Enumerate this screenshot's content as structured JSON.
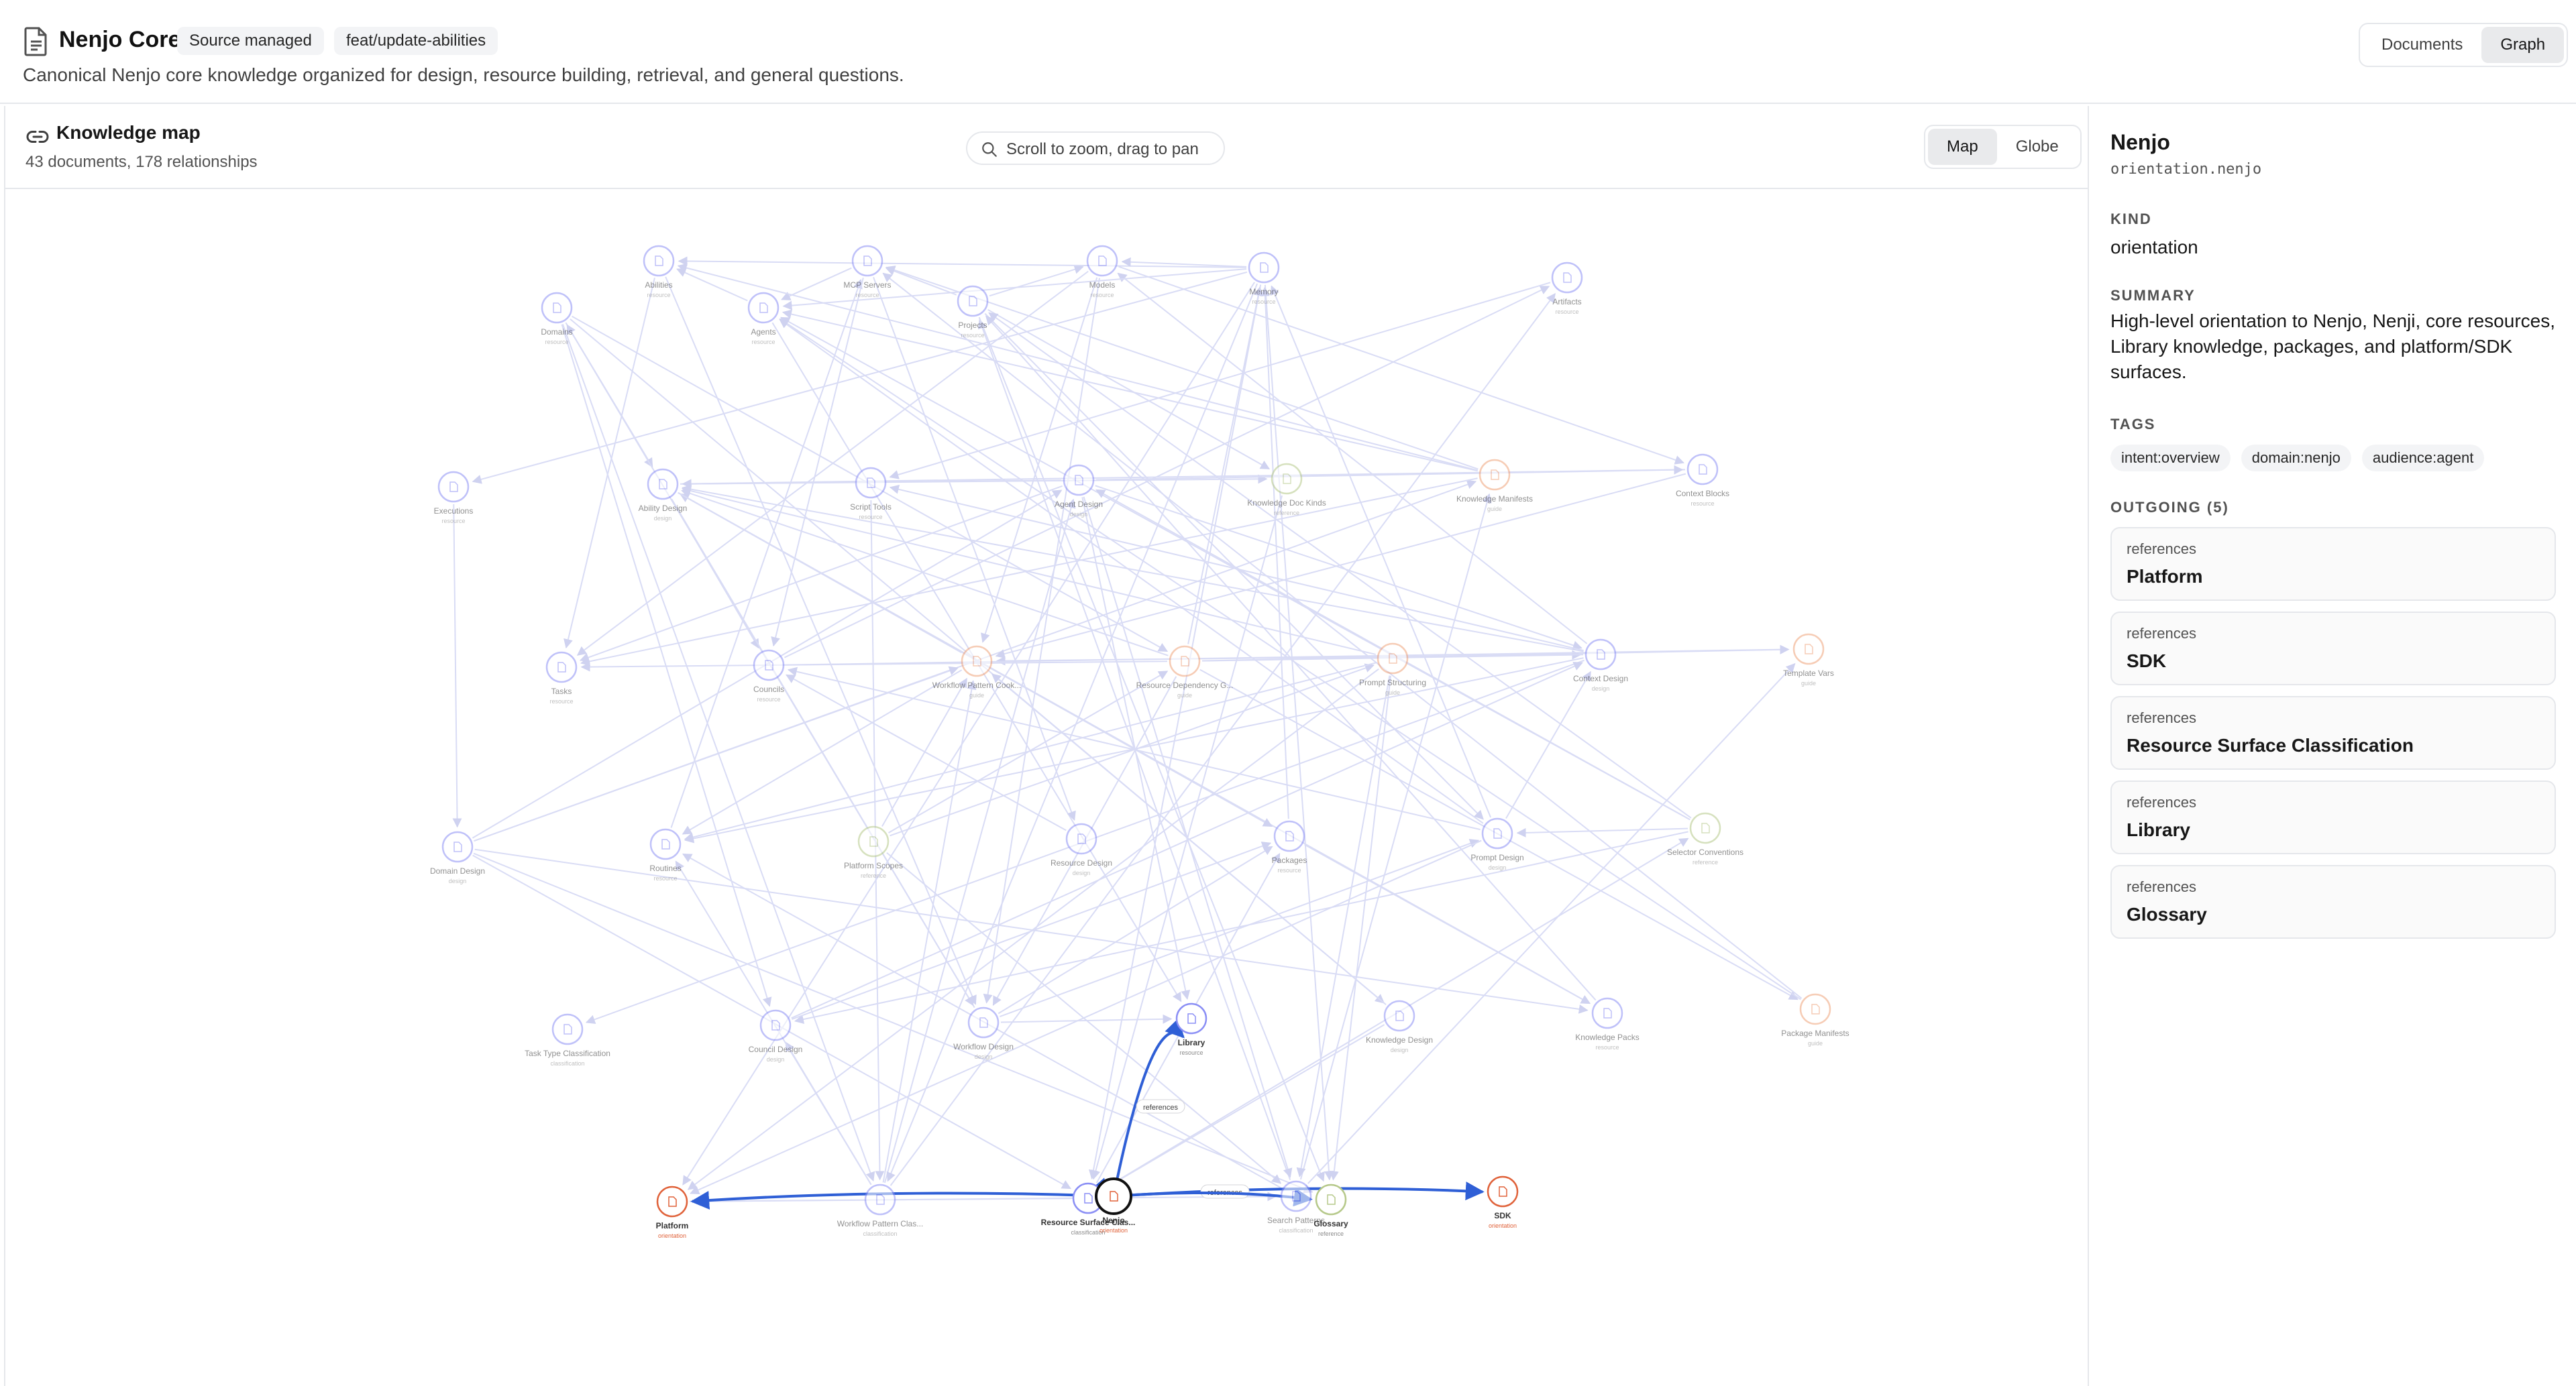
{
  "header": {
    "title": "Nenjo Core",
    "badge_source": "Source managed",
    "badge_branch": "feat/update-abilities",
    "subtitle": "Canonical Nenjo core knowledge organized for design, resource building, retrieval, and general questions.",
    "view_documents": "Documents",
    "view_graph": "Graph"
  },
  "map": {
    "title": "Knowledge map",
    "stats": "43 documents, 178 relationships",
    "search_hint": "Scroll to zoom, drag to pan",
    "mode_map": "Map",
    "mode_globe": "Globe",
    "edge_label": "references",
    "nodes": [
      {
        "label": "Abilities",
        "kind": "resource",
        "tone": "blue"
      },
      {
        "label": "MCP Servers",
        "kind": "resource",
        "tone": "blue"
      },
      {
        "label": "Models",
        "kind": "resource",
        "tone": "blue"
      },
      {
        "label": "Memory",
        "kind": "resource",
        "tone": "blue"
      },
      {
        "label": "Artifacts",
        "kind": "resource",
        "tone": "blue"
      },
      {
        "label": "Domains",
        "kind": "resource",
        "tone": "blue"
      },
      {
        "label": "Agents",
        "kind": "resource",
        "tone": "blue"
      },
      {
        "label": "Projects",
        "kind": "resource",
        "tone": "blue"
      },
      {
        "label": "Executions",
        "kind": "resource",
        "tone": "blue"
      },
      {
        "label": "Ability Design",
        "kind": "design",
        "tone": "blue"
      },
      {
        "label": "Script Tools",
        "kind": "resource",
        "tone": "blue"
      },
      {
        "label": "Agent Design",
        "kind": "design",
        "tone": "blue"
      },
      {
        "label": "Knowledge Doc Kinds",
        "kind": "reference",
        "tone": "green"
      },
      {
        "label": "Knowledge Manifests",
        "kind": "guide",
        "tone": "orange"
      },
      {
        "label": "Context Blocks",
        "kind": "resource",
        "tone": "blue"
      },
      {
        "label": "Tasks",
        "kind": "resource",
        "tone": "blue"
      },
      {
        "label": "Councils",
        "kind": "resource",
        "tone": "blue"
      },
      {
        "label": "Workflow Pattern Cook...",
        "kind": "guide",
        "tone": "orange"
      },
      {
        "label": "Resource Dependency G...",
        "kind": "guide",
        "tone": "orange"
      },
      {
        "label": "Prompt Structuring",
        "kind": "guide",
        "tone": "orange"
      },
      {
        "label": "Context Design",
        "kind": "design",
        "tone": "blue"
      },
      {
        "label": "Template Vars",
        "kind": "guide",
        "tone": "orange"
      },
      {
        "label": "Domain Design",
        "kind": "design",
        "tone": "blue"
      },
      {
        "label": "Routines",
        "kind": "resource",
        "tone": "blue"
      },
      {
        "label": "Platform Scopes",
        "kind": "reference",
        "tone": "green"
      },
      {
        "label": "Resource Design",
        "kind": "design",
        "tone": "blue"
      },
      {
        "label": "Packages",
        "kind": "resource",
        "tone": "blue"
      },
      {
        "label": "Prompt Design",
        "kind": "design",
        "tone": "blue"
      },
      {
        "label": "Selector Conventions",
        "kind": "reference",
        "tone": "green"
      },
      {
        "label": "Task Type Classification",
        "kind": "classification",
        "tone": "blue"
      },
      {
        "label": "Council Design",
        "kind": "design",
        "tone": "blue"
      },
      {
        "label": "Workflow Design",
        "kind": "design",
        "tone": "blue"
      },
      {
        "label": "Library",
        "kind": "resource",
        "tone": "blue"
      },
      {
        "label": "Knowledge Design",
        "kind": "design",
        "tone": "blue"
      },
      {
        "label": "Knowledge Packs",
        "kind": "resource",
        "tone": "blue"
      },
      {
        "label": "Package Manifests",
        "kind": "guide",
        "tone": "orange"
      },
      {
        "label": "Platform",
        "kind": "orientation",
        "tone": "red"
      },
      {
        "label": "Workflow Pattern Clas...",
        "kind": "classification",
        "tone": "blue"
      },
      {
        "label": "Resource Surface Clas...",
        "kind": "classification",
        "tone": "blue"
      },
      {
        "label": "Nenjo",
        "kind": "orientation",
        "tone": "red"
      },
      {
        "label": "Search Patterns",
        "kind": "classification",
        "tone": "blue"
      },
      {
        "label": "Glossary",
        "kind": "reference",
        "tone": "green"
      },
      {
        "label": "SDK",
        "kind": "orientation",
        "tone": "red"
      }
    ]
  },
  "details": {
    "name": "Nenjo",
    "id": "orientation.nenjo",
    "kind_label": "KIND",
    "kind": "orientation",
    "summary_label": "SUMMARY",
    "summary": "High-level orientation to Nenjo, Nenji, core resources, Library knowledge, packages, and platform/SDK surfaces.",
    "tags_label": "TAGS",
    "tags": [
      "intent:overview",
      "domain:nenjo",
      "audience:agent"
    ],
    "outgoing_label": "OUTGOING (5)",
    "outgoing": [
      {
        "relation": "references",
        "target": "Platform"
      },
      {
        "relation": "references",
        "target": "SDK"
      },
      {
        "relation": "references",
        "target": "Resource Surface Classification"
      },
      {
        "relation": "references",
        "target": "Library"
      },
      {
        "relation": "references",
        "target": "Glossary"
      }
    ]
  },
  "colors": {
    "blue": "#8b8ff5",
    "orange": "#f0a37a",
    "green": "#b6c98a",
    "red": "#e0623a",
    "edge": "#d9dcf5",
    "highlight": "#2f5fd6"
  }
}
